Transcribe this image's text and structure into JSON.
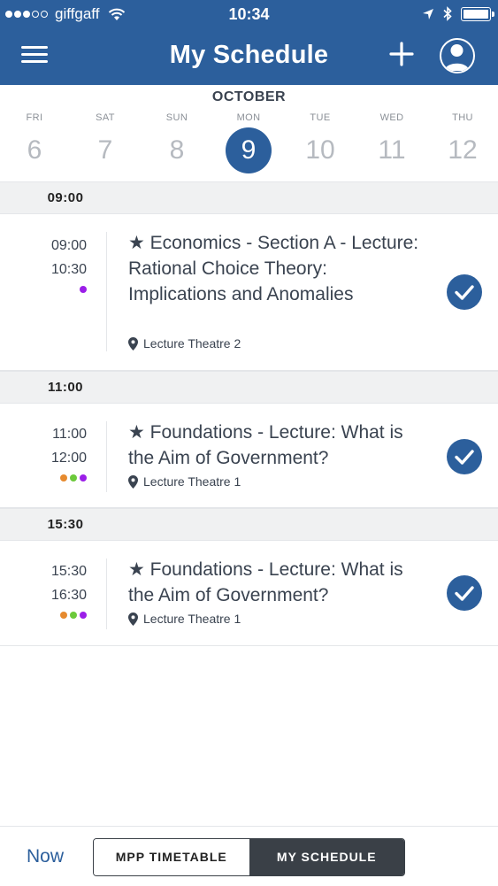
{
  "status_bar": {
    "carrier": "giffgaff",
    "time": "10:34"
  },
  "nav": {
    "title": "My Schedule"
  },
  "calendar": {
    "month": "OCTOBER",
    "days": [
      {
        "name": "FRI",
        "num": "6"
      },
      {
        "name": "SAT",
        "num": "7"
      },
      {
        "name": "SUN",
        "num": "8"
      },
      {
        "name": "MON",
        "num": "9"
      },
      {
        "name": "TUE",
        "num": "10"
      },
      {
        "name": "WED",
        "num": "11"
      },
      {
        "name": "THU",
        "num": "12"
      }
    ],
    "selected_index": 3
  },
  "schedule": {
    "groups": [
      {
        "time_header": "09:00",
        "event": {
          "start": "09:00",
          "end": "10:30",
          "title": "★ Economics - Section A - Lecture: Rational Choice Theory: Implications and Anomalies",
          "location": "Lecture Theatre 2",
          "dot_colors": [
            "#9b1ee8"
          ]
        }
      },
      {
        "time_header": "11:00",
        "event": {
          "start": "11:00",
          "end": "12:00",
          "title": "★ Foundations - Lecture: What is the Aim of Government?",
          "location": "Lecture Theatre 1",
          "dot_colors": [
            "#e68a2e",
            "#6cc93b",
            "#9b1ee8"
          ]
        }
      },
      {
        "time_header": "15:30",
        "event": {
          "start": "15:30",
          "end": "16:30",
          "title": "★ Foundations - Lecture: What is the Aim of Government?",
          "location": "Lecture Theatre 1",
          "dot_colors": [
            "#e68a2e",
            "#6cc93b",
            "#9b1ee8"
          ]
        }
      }
    ]
  },
  "footer": {
    "now_label": "Now",
    "segments": [
      "MPP TIMETABLE",
      "MY SCHEDULE"
    ],
    "active_segment": 1
  },
  "colors": {
    "brand": "#2c5f9c",
    "text": "#3a4350"
  }
}
